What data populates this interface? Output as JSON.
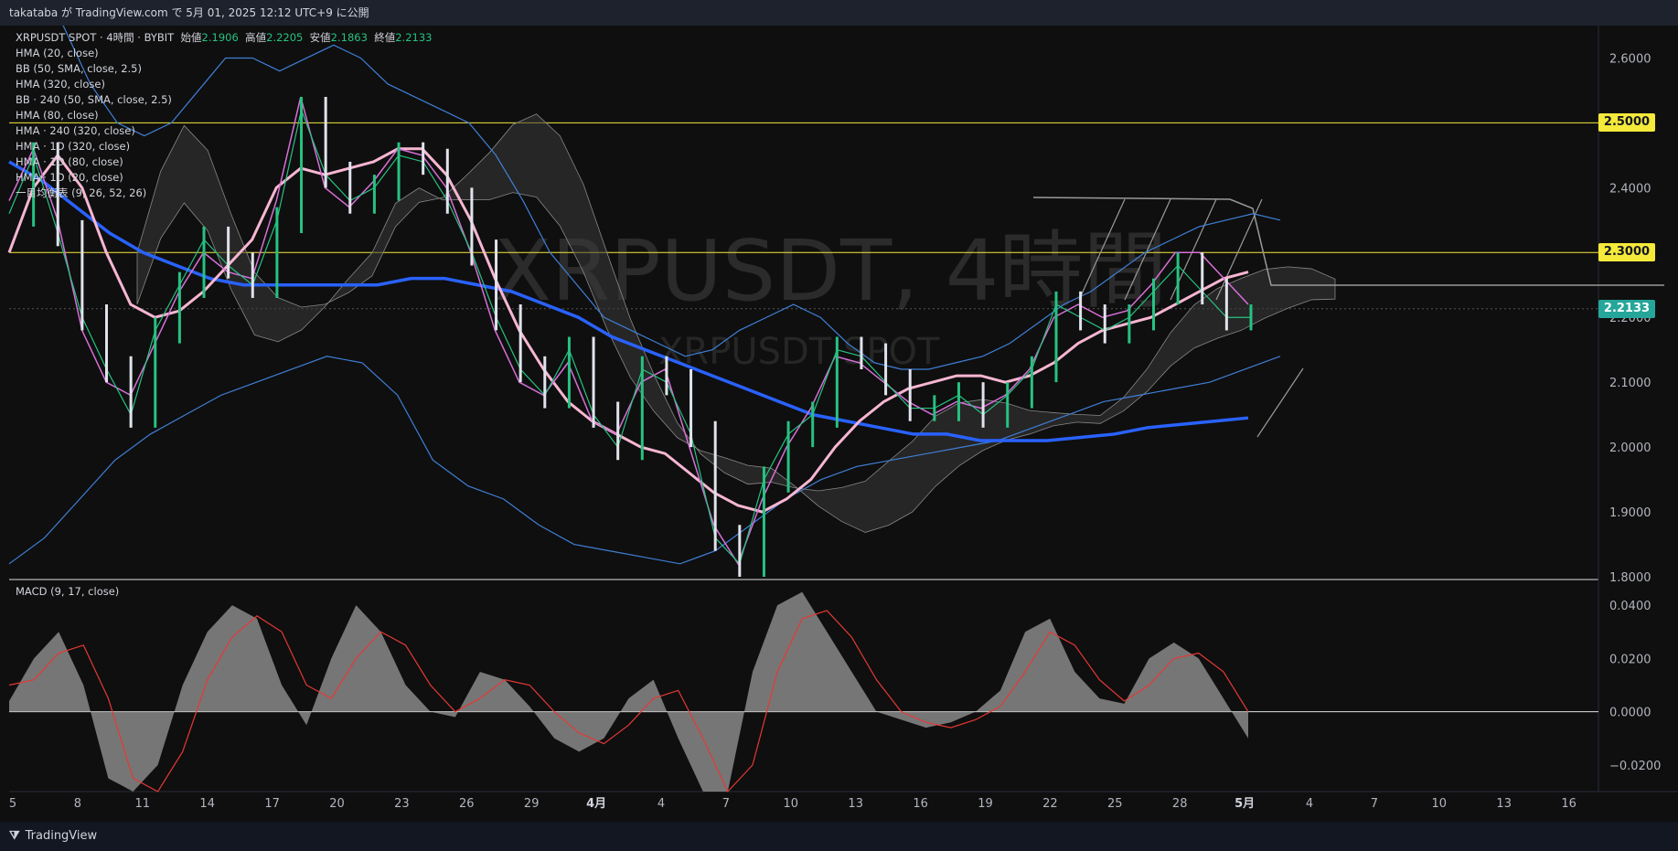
{
  "header": {
    "publish_line": "takataba が TradingView.com で 5月 01, 2025 12:12 UTC+9 に公開"
  },
  "legend": {
    "symbol_line": "XRPUSDT SPOT · 4時間 · BYBIT",
    "open_label": "始値",
    "open": "2.1906",
    "high_label": "高値",
    "high": "2.2205",
    "low_label": "安値",
    "low": "2.1863",
    "close_label": "終値",
    "close": "2.2133",
    "indicators": [
      "HMA (20, close)",
      "BB (50, SMA, close, 2.5)",
      "HMA (320, close)",
      "BB · 240 (50, SMA, close, 2.5)",
      "HMA (80, close)",
      "HMA · 240 (320, close)",
      "HMA · 1D (320, close)",
      "HMA · 1D (80, close)",
      "HMA · 1D (20, close)",
      "一目均衡表 (9, 26, 52, 26)"
    ]
  },
  "watermark": {
    "main": "XRPUSDT, 4時間",
    "sub": "XRPUSDT SPOT"
  },
  "macd_title": "MACD (9, 17, close)",
  "price_tags": [
    {
      "label": "2.5000",
      "value": 2.5,
      "bg": "#f5e93a",
      "fg": "#131722"
    },
    {
      "label": "2.3000",
      "value": 2.3,
      "bg": "#f5e93a",
      "fg": "#131722"
    },
    {
      "label": "2.2133",
      "value": 2.2133,
      "bg": "#26a69a",
      "fg": "#ffffff"
    }
  ],
  "footer": {
    "logo_text": "TradingView"
  },
  "colors": {
    "up": "#26c281",
    "down": "#e0e3eb",
    "hma20": "#d86fd8",
    "hma80": "#f7b6d2",
    "hma320": "#2962ff",
    "bb": "#3f7fd6",
    "ichimoku_cloud": "#3a3a3a",
    "hline": "#f5e93a",
    "macd_hist": "#9a9a9a",
    "macd_signal": "#e53935"
  },
  "chart_data": [
    {
      "type": "line",
      "title": "XRPUSDT SPOT · 4時間 · BYBIT",
      "ylim": [
        1.8,
        2.65
      ],
      "y_ticks": [
        2.6,
        2.5,
        2.4,
        2.3,
        2.2,
        2.1,
        2.0,
        1.9,
        1.8
      ],
      "y_tick_labels": [
        "2.6000",
        "2.5000",
        "2.4000",
        "2.3000",
        "2.2000",
        "2.1000",
        "2.0000",
        "1.9000",
        "1.8000"
      ],
      "x_tick_labels": [
        "5",
        "8",
        "11",
        "14",
        "17",
        "20",
        "23",
        "26",
        "29",
        "4月",
        "4",
        "7",
        "10",
        "13",
        "16",
        "19",
        "22",
        "25",
        "28",
        "5月",
        "4",
        "7",
        "10",
        "13",
        "16"
      ],
      "horizontal_lines": [
        2.5,
        2.3
      ],
      "last_price": 2.2133,
      "series": [
        {
          "key": "price",
          "values": [
            2.36,
            2.45,
            2.33,
            2.2,
            2.12,
            2.05,
            2.18,
            2.25,
            2.32,
            2.28,
            2.25,
            2.35,
            2.52,
            2.42,
            2.38,
            2.4,
            2.45,
            2.44,
            2.38,
            2.3,
            2.2,
            2.12,
            2.08,
            2.15,
            2.05,
            2.0,
            2.12,
            2.1,
            2.02,
            1.86,
            1.82,
            1.95,
            2.02,
            2.05,
            2.15,
            2.14,
            2.1,
            2.06,
            2.06,
            2.08,
            2.05,
            2.08,
            2.12,
            2.22,
            2.2,
            2.18,
            2.2,
            2.24,
            2.28,
            2.24,
            2.2,
            2.2
          ]
        },
        {
          "key": "hma20",
          "values": [
            2.38,
            2.46,
            2.35,
            2.18,
            2.1,
            2.08,
            2.16,
            2.24,
            2.3,
            2.27,
            2.26,
            2.38,
            2.54,
            2.4,
            2.37,
            2.41,
            2.46,
            2.45,
            2.4,
            2.3,
            2.18,
            2.1,
            2.08,
            2.13,
            2.04,
            2.02,
            2.1,
            2.12,
            2.0,
            1.88,
            1.82,
            1.92,
            2.0,
            2.06,
            2.14,
            2.13,
            2.1,
            2.07,
            2.05,
            2.07,
            2.06,
            2.08,
            2.12,
            2.2,
            2.22,
            2.2,
            2.21,
            2.25,
            2.3,
            2.3,
            2.26,
            2.22
          ]
        },
        {
          "key": "hma80",
          "values": [
            2.3,
            2.4,
            2.45,
            2.4,
            2.3,
            2.22,
            2.2,
            2.21,
            2.24,
            2.28,
            2.32,
            2.4,
            2.43,
            2.42,
            2.43,
            2.44,
            2.46,
            2.46,
            2.42,
            2.35,
            2.26,
            2.18,
            2.12,
            2.07,
            2.04,
            2.02,
            2.0,
            1.99,
            1.96,
            1.93,
            1.91,
            1.9,
            1.92,
            1.95,
            2.0,
            2.04,
            2.07,
            2.09,
            2.1,
            2.11,
            2.11,
            2.1,
            2.11,
            2.13,
            2.16,
            2.18,
            2.19,
            2.2,
            2.22,
            2.24,
            2.26,
            2.27
          ]
        },
        {
          "key": "hma320",
          "values": [
            2.44,
            2.41,
            2.37,
            2.33,
            2.3,
            2.28,
            2.26,
            2.25,
            2.25,
            2.25,
            2.25,
            2.25,
            2.26,
            2.26,
            2.25,
            2.24,
            2.22,
            2.2,
            2.17,
            2.15,
            2.13,
            2.11,
            2.09,
            2.07,
            2.05,
            2.04,
            2.03,
            2.02,
            2.02,
            2.01,
            2.01,
            2.01,
            2.015,
            2.02,
            2.03,
            2.035,
            2.04,
            2.045
          ]
        },
        {
          "key": "bb_upper",
          "values": [
            2.8,
            2.74,
            2.65,
            2.56,
            2.5,
            2.48,
            2.5,
            2.55,
            2.6,
            2.6,
            2.58,
            2.6,
            2.62,
            2.6,
            2.56,
            2.54,
            2.52,
            2.5,
            2.45,
            2.38,
            2.3,
            2.25,
            2.2,
            2.18,
            2.16,
            2.14,
            2.15,
            2.18,
            2.2,
            2.22,
            2.2,
            2.16,
            2.13,
            2.12,
            2.12,
            2.13,
            2.14,
            2.16,
            2.19,
            2.22,
            2.24,
            2.27,
            2.3,
            2.32,
            2.34,
            2.35,
            2.36,
            2.35
          ]
        },
        {
          "key": "bb_lower",
          "values": [
            1.82,
            1.86,
            1.92,
            1.98,
            2.02,
            2.05,
            2.08,
            2.1,
            2.12,
            2.14,
            2.13,
            2.08,
            1.98,
            1.94,
            1.92,
            1.88,
            1.85,
            1.84,
            1.83,
            1.82,
            1.84,
            1.88,
            1.92,
            1.95,
            1.97,
            1.98,
            1.99,
            2.0,
            2.01,
            2.03,
            2.05,
            2.07,
            2.08,
            2.09,
            2.1,
            2.12,
            2.14
          ]
        }
      ]
    },
    {
      "type": "area",
      "title": "MACD (9, 17, close)",
      "ylim": [
        -0.03,
        0.05
      ],
      "y_ticks": [
        0.04,
        0.02,
        0.0,
        -0.02
      ],
      "y_tick_labels": [
        "0.0400",
        "0.0200",
        "0.0000",
        "−0.0200"
      ],
      "series": [
        {
          "key": "macd",
          "values": [
            0.004,
            0.02,
            0.03,
            0.01,
            -0.025,
            -0.04,
            -0.02,
            0.01,
            0.03,
            0.04,
            0.035,
            0.01,
            -0.005,
            0.02,
            0.04,
            0.03,
            0.01,
            0.0,
            -0.002,
            0.015,
            0.012,
            0.002,
            -0.01,
            -0.015,
            -0.01,
            0.005,
            0.012,
            -0.01,
            -0.03,
            -0.04,
            0.015,
            0.04,
            0.045,
            0.03,
            0.015,
            0.0,
            -0.003,
            -0.006,
            -0.004,
            0.0,
            0.008,
            0.03,
            0.035,
            0.015,
            0.005,
            0.003,
            0.02,
            0.026,
            0.02,
            0.005,
            -0.01
          ]
        },
        {
          "key": "signal",
          "values": [
            0.01,
            0.012,
            0.022,
            0.025,
            0.005,
            -0.025,
            -0.035,
            -0.015,
            0.012,
            0.028,
            0.036,
            0.03,
            0.01,
            0.005,
            0.02,
            0.03,
            0.025,
            0.01,
            0.0,
            0.005,
            0.012,
            0.01,
            0.0,
            -0.008,
            -0.012,
            -0.005,
            0.005,
            0.008,
            -0.01,
            -0.03,
            -0.02,
            0.015,
            0.035,
            0.038,
            0.028,
            0.012,
            0.0,
            -0.004,
            -0.006,
            -0.003,
            0.002,
            0.015,
            0.03,
            0.025,
            0.012,
            0.004,
            0.01,
            0.02,
            0.022,
            0.015,
            0.0
          ]
        }
      ]
    }
  ]
}
